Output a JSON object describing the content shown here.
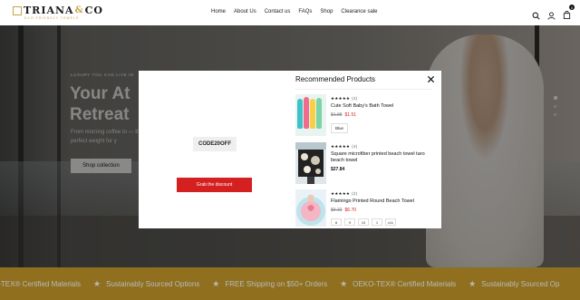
{
  "header": {
    "logo_left": "TRIANA",
    "logo_amp": "&",
    "logo_right": "CO",
    "logo_tagline": "ECO-FRIENDLY TOWELS",
    "nav": [
      "Home",
      "About Us",
      "Contact us",
      "FAQs",
      "Shop",
      "Clearance sale"
    ],
    "cart_count": "0"
  },
  "hero": {
    "eyebrow": "LUXURY YOU CAN LIVE IN",
    "title": "Your At Retreat",
    "description": "From morning coffee to — the perfect weight for y",
    "button": "Shop collection"
  },
  "marquee": [
    "O-TEX® Certified Materials",
    "Sustainably Sourced Options",
    "FREE Shipping on $50+ Orders",
    "OEKO-TEX® Certified Materials",
    "Sustainably Sourced Op"
  ],
  "modal": {
    "code": "CODE20OFF",
    "grab_button": "Grab the discount",
    "rec_title": "Recommended Products",
    "products": [
      {
        "stars": "★★★★★",
        "count": "(4)",
        "name": "Cute Soft Baby's Bath Towel",
        "old_price": "$1.88",
        "price": "$1.51",
        "variant": "Blue"
      },
      {
        "stars": "★★★★★",
        "count": "(4)",
        "name": "Square microfiber printed beach towel taro beach towel",
        "price": "$27.84"
      },
      {
        "stars": "★★★★★",
        "count": "(2)",
        "name": "Flamingo Printed Round Beach Towel",
        "old_price": "$9.32",
        "price": "$6.70",
        "sizes": [
          "8",
          "9",
          "10",
          "1",
          "x11"
        ]
      }
    ]
  },
  "colors": {
    "accent_gold": "#c89b2c",
    "sale_red": "#d42020"
  }
}
